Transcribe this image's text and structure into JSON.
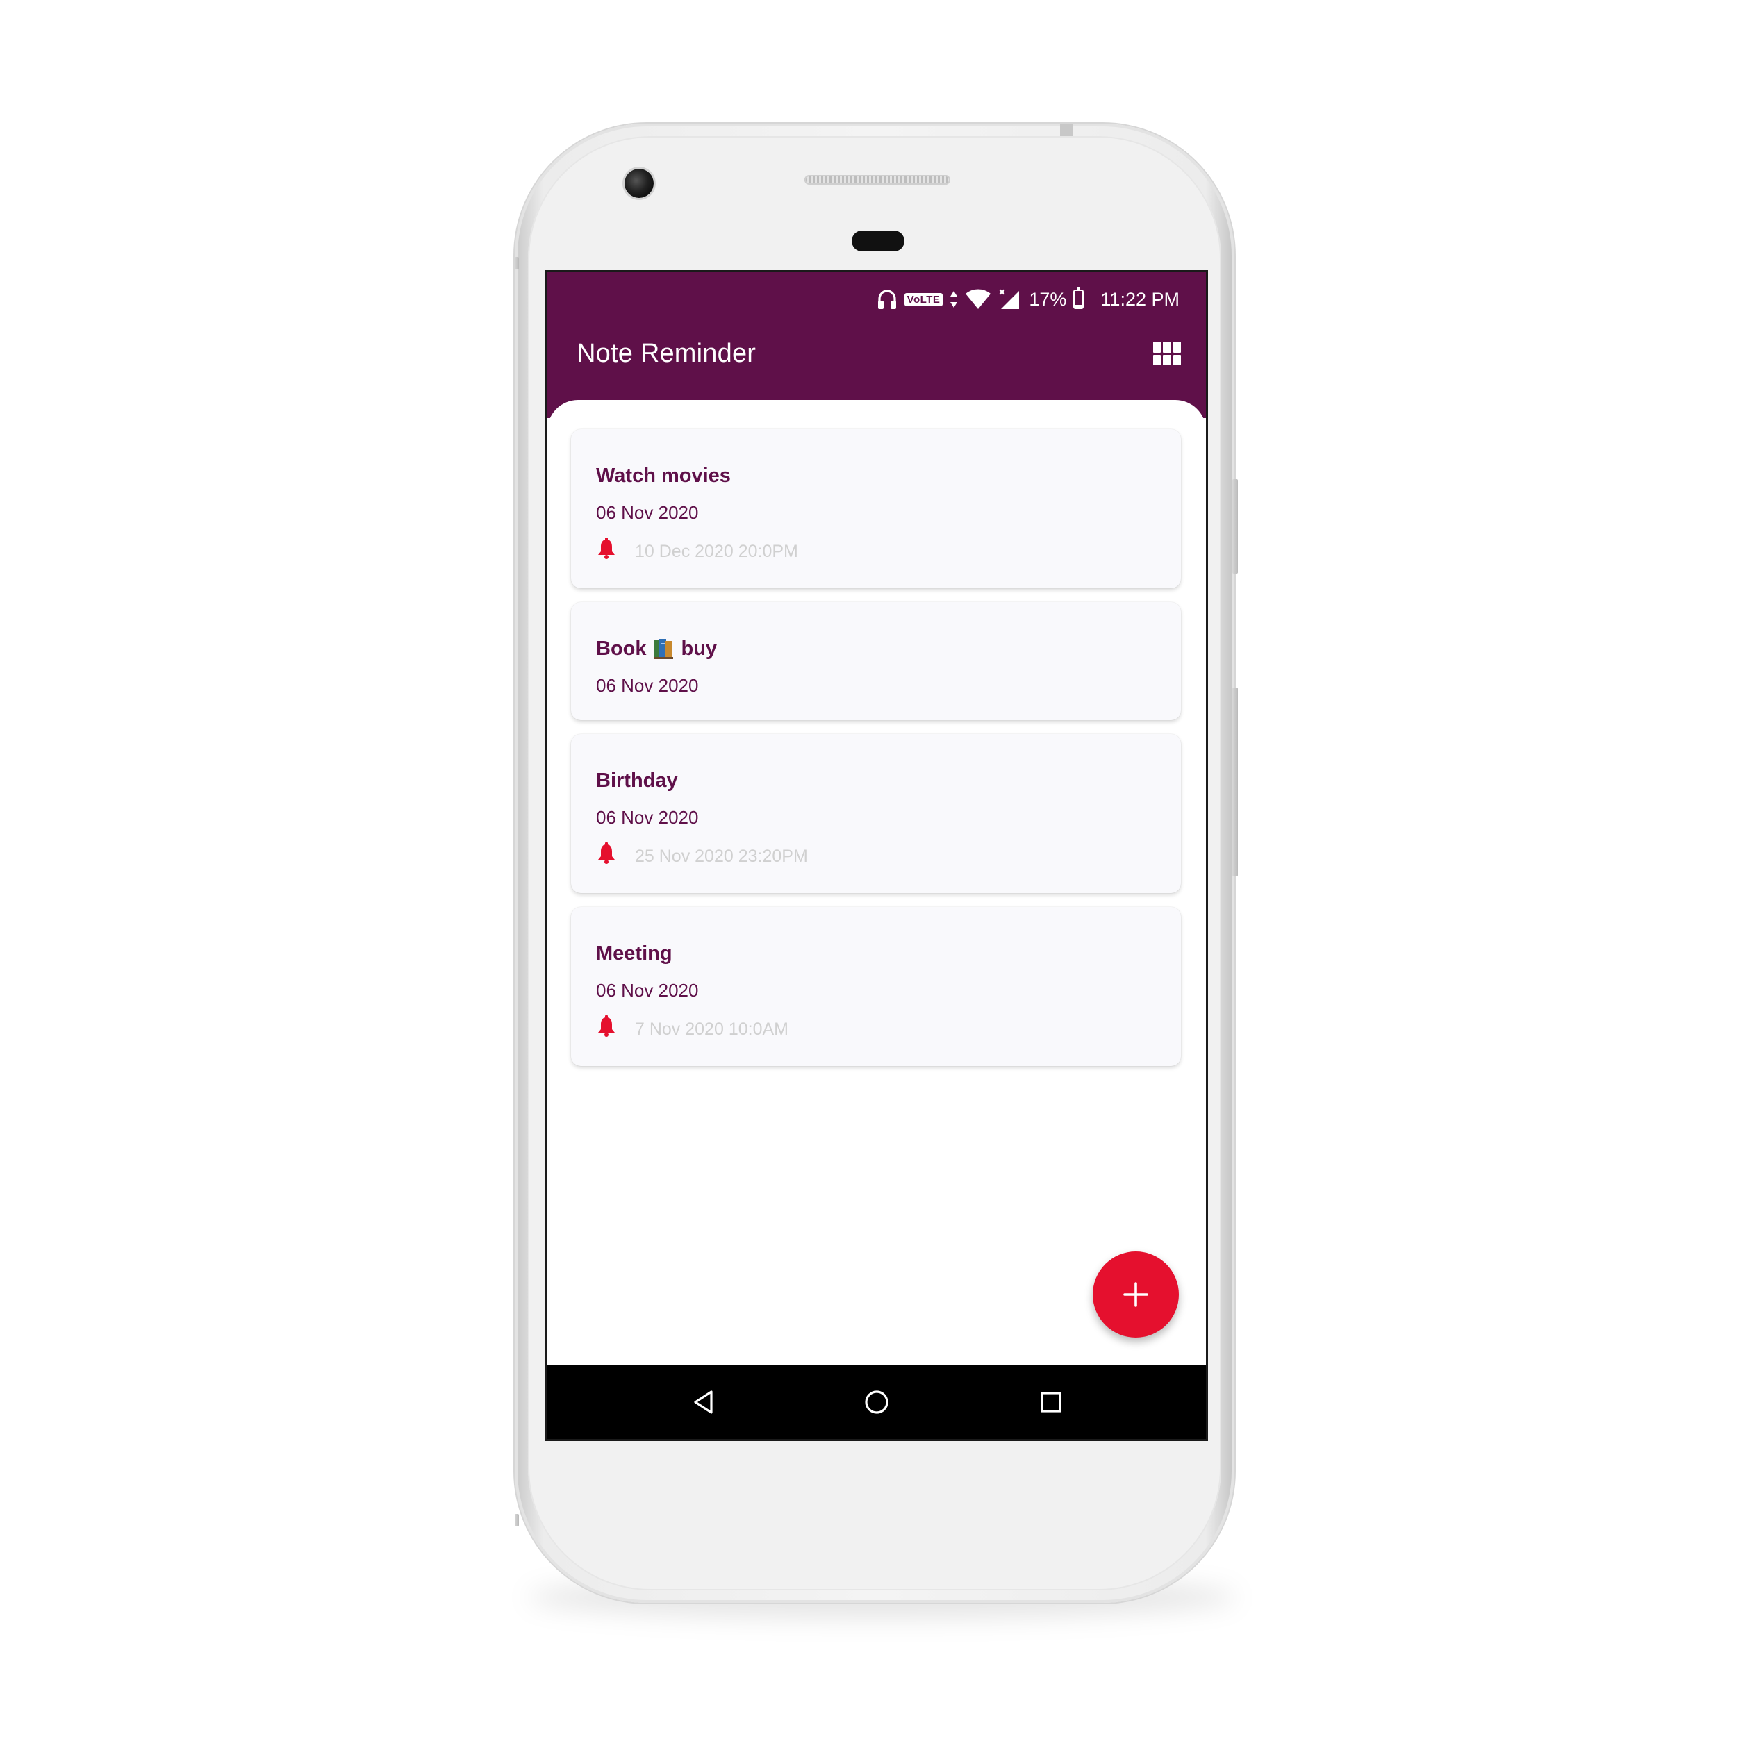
{
  "status_bar": {
    "volte_label": "VoLTE",
    "battery_text": "17%",
    "battery_level": 0.17,
    "time": "11:22 PM",
    "icons": [
      "headphones-icon",
      "volte-icon",
      "data-arrows-icon",
      "wifi-icon",
      "cell-signal-icon",
      "battery-icon"
    ]
  },
  "app_bar": {
    "title": "Note Reminder",
    "view_toggle_icon": "grid-view-icon"
  },
  "notes": [
    {
      "title_before": "Watch movies",
      "title_after": "",
      "has_book_emoji": false,
      "date": "06 Nov 2020",
      "reminder": "10 Dec 2020 20:0PM"
    },
    {
      "title_before": "Book",
      "title_after": "buy",
      "has_book_emoji": true,
      "date": "06 Nov 2020",
      "reminder": ""
    },
    {
      "title_before": "Birthday",
      "title_after": "",
      "has_book_emoji": false,
      "date": "06 Nov 2020",
      "reminder": "25 Nov 2020 23:20PM"
    },
    {
      "title_before": "Meeting",
      "title_after": "",
      "has_book_emoji": false,
      "date": "06 Nov 2020",
      "reminder": "7 Nov 2020 10:0AM"
    }
  ],
  "fab": {
    "icon": "plus-icon"
  },
  "nav_bar": {
    "icons": [
      "back-icon",
      "home-icon",
      "recents-icon"
    ]
  },
  "colors": {
    "primary": "#5f1049",
    "accent": "#e5102e",
    "reminder_text": "#d0d0d0",
    "card_background": "#f9f9fc"
  }
}
